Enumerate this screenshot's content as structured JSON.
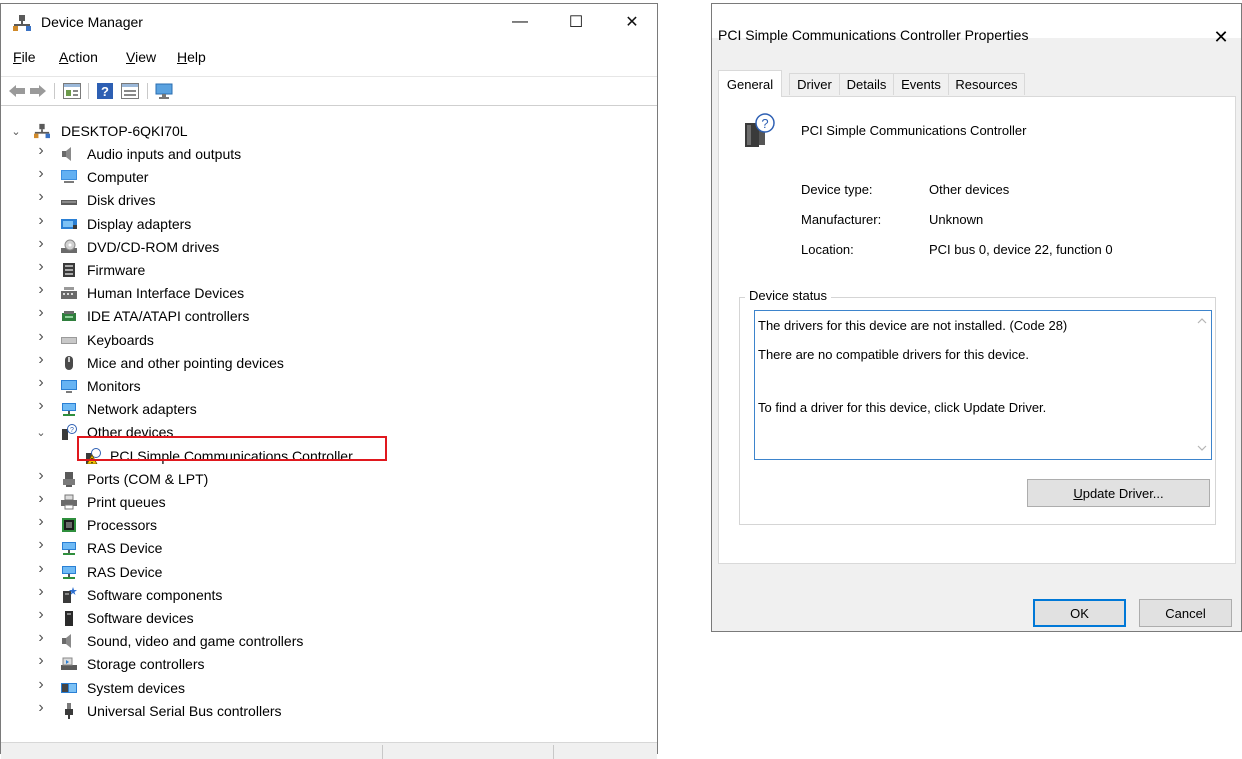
{
  "device_manager": {
    "title": "Device Manager",
    "caption_buttons": {
      "minimize": "—",
      "maximize": "☐",
      "close": "✕"
    },
    "menu": [
      {
        "label": "File",
        "accel": "F",
        "rest": "ile"
      },
      {
        "label": "Action",
        "accel": "A",
        "rest": "ction"
      },
      {
        "label": "View",
        "accel": "V",
        "rest": "iew"
      },
      {
        "label": "Help",
        "accel": "H",
        "rest": "elp"
      }
    ],
    "toolbar_icons": [
      "back-arrow-icon",
      "forward-arrow-icon",
      "properties-icon",
      "help-icon",
      "update-driver-icon",
      "scan-hardware-icon"
    ],
    "root": "DESKTOP-6QKI70L",
    "tree_items": [
      {
        "label": "Audio inputs and outputs",
        "icon": "speaker-icon",
        "expanded": false
      },
      {
        "label": "Computer",
        "icon": "computer-icon",
        "expanded": false
      },
      {
        "label": "Disk drives",
        "icon": "disk-drive-icon",
        "expanded": false
      },
      {
        "label": "Display adapters",
        "icon": "display-adapter-icon",
        "expanded": false
      },
      {
        "label": "DVD/CD-ROM drives",
        "icon": "dvd-drive-icon",
        "expanded": false
      },
      {
        "label": "Firmware",
        "icon": "firmware-icon",
        "expanded": false
      },
      {
        "label": "Human Interface Devices",
        "icon": "hid-icon",
        "expanded": false
      },
      {
        "label": "IDE ATA/ATAPI controllers",
        "icon": "ide-controller-icon",
        "expanded": false
      },
      {
        "label": "Keyboards",
        "icon": "keyboard-icon",
        "expanded": false
      },
      {
        "label": "Mice and other pointing devices",
        "icon": "mouse-icon",
        "expanded": false
      },
      {
        "label": "Monitors",
        "icon": "monitor-icon",
        "expanded": false
      },
      {
        "label": "Network adapters",
        "icon": "network-adapter-icon",
        "expanded": false
      },
      {
        "label": "Other devices",
        "icon": "unknown-device-icon",
        "expanded": true
      },
      {
        "label": "PCI Simple Communications Controller",
        "icon": "warning-device-icon",
        "child": true
      },
      {
        "label": "Ports (COM & LPT)",
        "icon": "port-icon",
        "expanded": false
      },
      {
        "label": "Print queues",
        "icon": "printer-icon",
        "expanded": false
      },
      {
        "label": "Processors",
        "icon": "processor-icon",
        "expanded": false
      },
      {
        "label": "RAS Device",
        "icon": "ras-device-icon",
        "expanded": false
      },
      {
        "label": "RAS Device",
        "icon": "ras-device-icon",
        "expanded": false
      },
      {
        "label": "Software components",
        "icon": "software-component-icon",
        "expanded": false
      },
      {
        "label": "Software devices",
        "icon": "software-device-icon",
        "expanded": false
      },
      {
        "label": "Sound, video and game controllers",
        "icon": "speaker-icon",
        "expanded": false
      },
      {
        "label": "Storage controllers",
        "icon": "storage-controller-icon",
        "expanded": false
      },
      {
        "label": "System devices",
        "icon": "system-device-icon",
        "expanded": false
      },
      {
        "label": "Universal Serial Bus controllers",
        "icon": "usb-icon",
        "expanded": false
      }
    ],
    "highlight_color": "#e0181e"
  },
  "properties": {
    "title": "PCI Simple Communications Controller Properties",
    "close_glyph": "✕",
    "tabs": [
      "General",
      "Driver",
      "Details",
      "Events",
      "Resources"
    ],
    "active_tab": "General",
    "device_name": "PCI Simple Communications Controller",
    "props": [
      {
        "label": "Device type:",
        "value": "Other devices"
      },
      {
        "label": "Manufacturer:",
        "value": "Unknown"
      },
      {
        "label": "Location:",
        "value": "PCI bus 0, device 22, function 0"
      }
    ],
    "status_legend": "Device status",
    "status_lines": [
      "The drivers for this device are not installed. (Code 28)",
      "There are no compatible drivers for this device.",
      "To find a driver for this device, click Update Driver."
    ],
    "update_button": {
      "accel": "U",
      "rest": "pdate Driver..."
    },
    "ok": "OK",
    "cancel": "Cancel",
    "accent_color": "#0078d7"
  }
}
